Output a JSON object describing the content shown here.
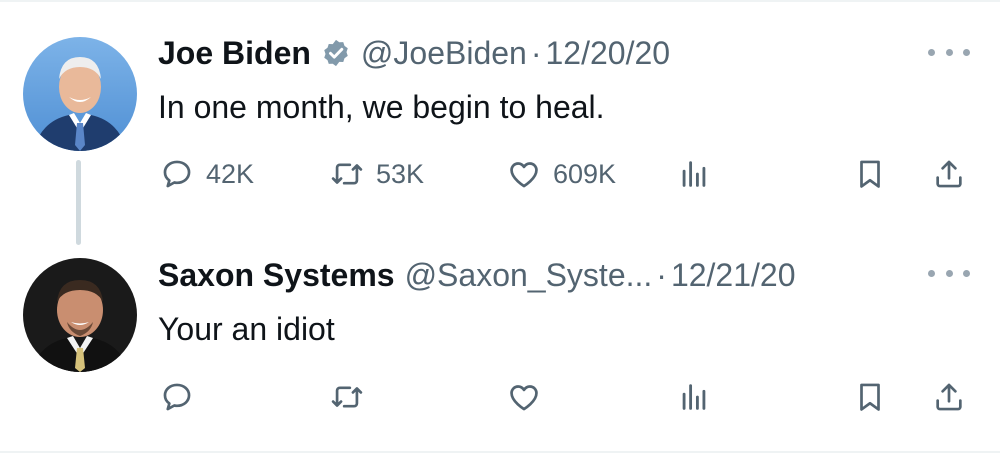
{
  "tweets": [
    {
      "name": "Joe Biden",
      "handle": "@JoeBiden",
      "separator": "·",
      "time": "12/20/20",
      "text": "In one month, we begin to heal.",
      "verified": true,
      "stats": {
        "replies": "42K",
        "retweets": "53K",
        "likes": "609K"
      }
    },
    {
      "name": "Saxon Systems",
      "handle": "@Saxon_Syste...",
      "separator": "·",
      "time": "12/21/20",
      "text": "Your an idiot",
      "verified": false,
      "stats": {
        "replies": "",
        "retweets": "",
        "likes": ""
      }
    }
  ],
  "icons": [
    "verified-badge-icon",
    "more-options-icon",
    "reply-icon",
    "retweet-icon",
    "like-icon",
    "views-icon",
    "bookmark-icon",
    "share-icon"
  ],
  "colors": {
    "text": "#0f1419",
    "secondary": "#536471",
    "thread_line": "#cfd9de",
    "badge": "#829aab"
  }
}
